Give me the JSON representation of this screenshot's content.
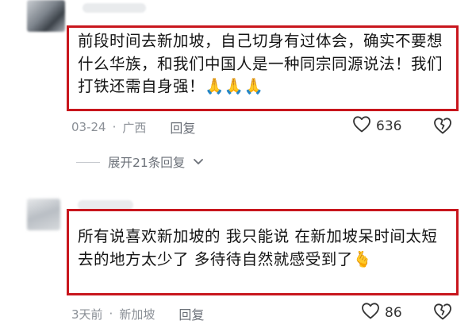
{
  "comments": [
    {
      "text": "前段时间去新加坡，自己切身有过体会，确实不要想什么华族，和我们中国人是一种同宗同源说法！我们打铁还需自身强！🙏🙏🙏",
      "date": "03-24",
      "separator": "·",
      "location": "广西",
      "reply_label": "回复",
      "like_count": "636"
    },
    {
      "text": "所有说喜欢新加坡的 我只能说 在新加坡呆时间太短 去的地方太少了 多待待自然就感受到了🫰",
      "date": "3天前",
      "separator": "·",
      "location": "新加坡",
      "reply_label": "回复",
      "like_count": "86"
    }
  ],
  "expand_replies": {
    "label": "展开21条回复"
  },
  "icons": {
    "like": "heart-outline-icon",
    "dislike": "broken-heart-outline-icon",
    "expand": "chevron-down-icon"
  },
  "colors": {
    "highlight_border": "#c8161d",
    "meta_text": "#8a8f96"
  }
}
